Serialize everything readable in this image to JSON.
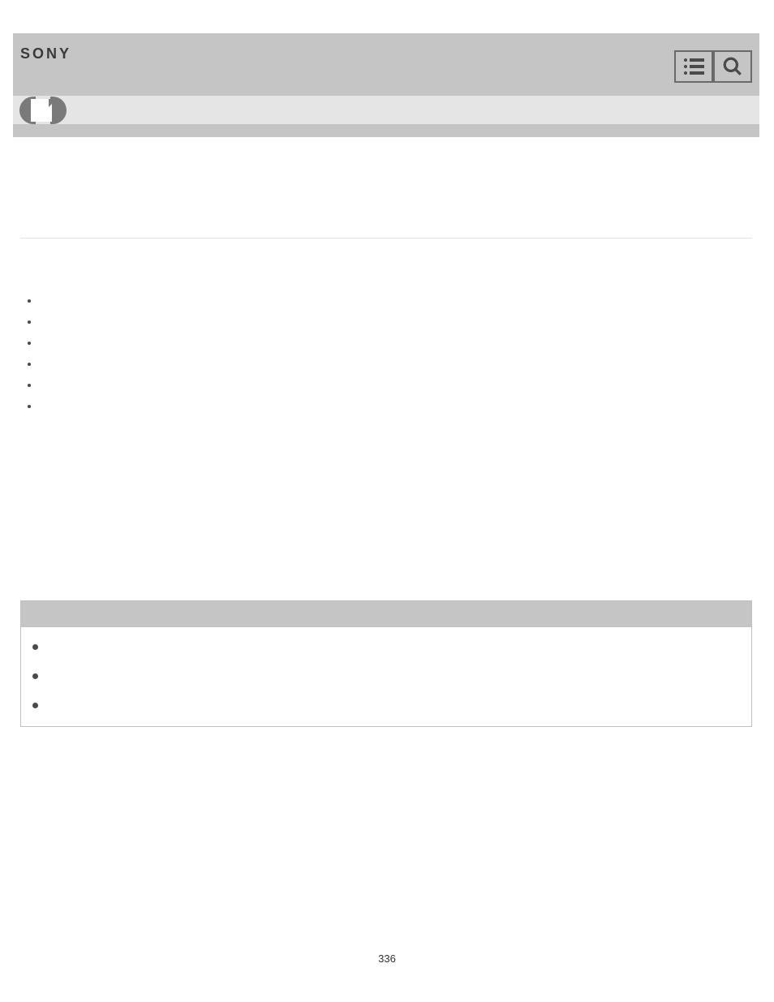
{
  "header": {
    "brand": "SONY"
  },
  "bullets": [
    "",
    "",
    "",
    "",
    "",
    ""
  ],
  "notes": [
    "",
    "",
    ""
  ],
  "pageNumber": "336"
}
